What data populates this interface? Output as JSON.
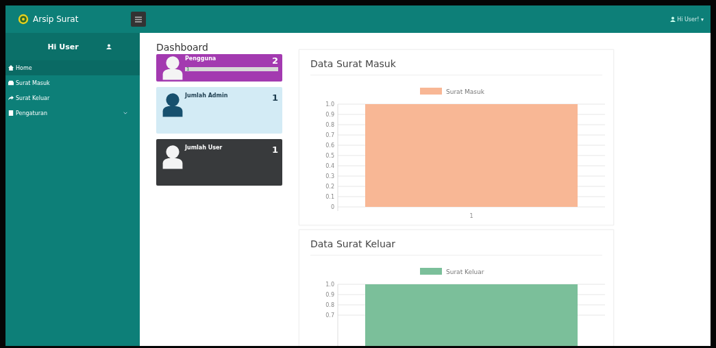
{
  "brand": {
    "name": "Arsip Surat"
  },
  "top_bar": {
    "user_menu": "Hi User! ▾"
  },
  "sidebar": {
    "greeting": "Hi User",
    "items": [
      {
        "label": "Home",
        "selected": true,
        "expandable": false
      },
      {
        "label": "Surat Masuk",
        "selected": false,
        "expandable": false
      },
      {
        "label": "Surat Keluar",
        "selected": false,
        "expandable": false
      },
      {
        "label": "Pengaturan",
        "selected": false,
        "expandable": true
      }
    ]
  },
  "page_title": "Dashboard",
  "stat_cards": [
    {
      "kind": "progress",
      "label": "Pengguna",
      "count": "2",
      "color": "#a33ab0",
      "progress": {
        "label": "1",
        "level": 1
      }
    },
    {
      "kind": "plain",
      "label": "Jumlah Admin",
      "count": "1",
      "color": "#d3ebf5"
    },
    {
      "kind": "plain",
      "label": "Jumlah User",
      "count": "1",
      "color": "#383a3c"
    }
  ],
  "charts": [
    {
      "title": "Data Surat Masuk",
      "chart_data": {
        "type": "bar",
        "grid": true,
        "categories": [
          "1"
        ],
        "series": [
          {
            "name": "Surat Masuk",
            "color": "#f8b795",
            "values": [
              1
            ]
          }
        ],
        "ylim": [
          0,
          1
        ],
        "yticks": [
          {
            "value": 0,
            "label": "0"
          },
          {
            "value": 0.1,
            "label": "0.1"
          },
          {
            "value": 0.2,
            "label": "0.2"
          },
          {
            "value": 0.3,
            "label": "0.3"
          },
          {
            "value": 0.4,
            "label": "0.4"
          },
          {
            "value": 0.5,
            "label": "0.5"
          },
          {
            "value": 0.6,
            "label": "0.6"
          },
          {
            "value": 0.7,
            "label": "0.7"
          },
          {
            "value": 0.8,
            "label": "0.8"
          },
          {
            "value": 0.9,
            "label": "0.9"
          },
          {
            "value": 1,
            "label": "1.0"
          }
        ]
      }
    },
    {
      "title": "Data Surat Keluar",
      "chart_data": {
        "type": "bar",
        "grid": true,
        "series": [
          {
            "name": "Surat Keluar",
            "color": "#7bbf9a",
            "values": [
              1
            ]
          }
        ],
        "ylim": [
          0,
          1
        ],
        "yticks": [
          {
            "value": 0.7,
            "label": "0.7"
          },
          {
            "value": 0.8,
            "label": "0.8"
          },
          {
            "value": 0.9,
            "label": "0.9"
          },
          {
            "value": 1,
            "label": "1.0"
          }
        ]
      }
    }
  ]
}
